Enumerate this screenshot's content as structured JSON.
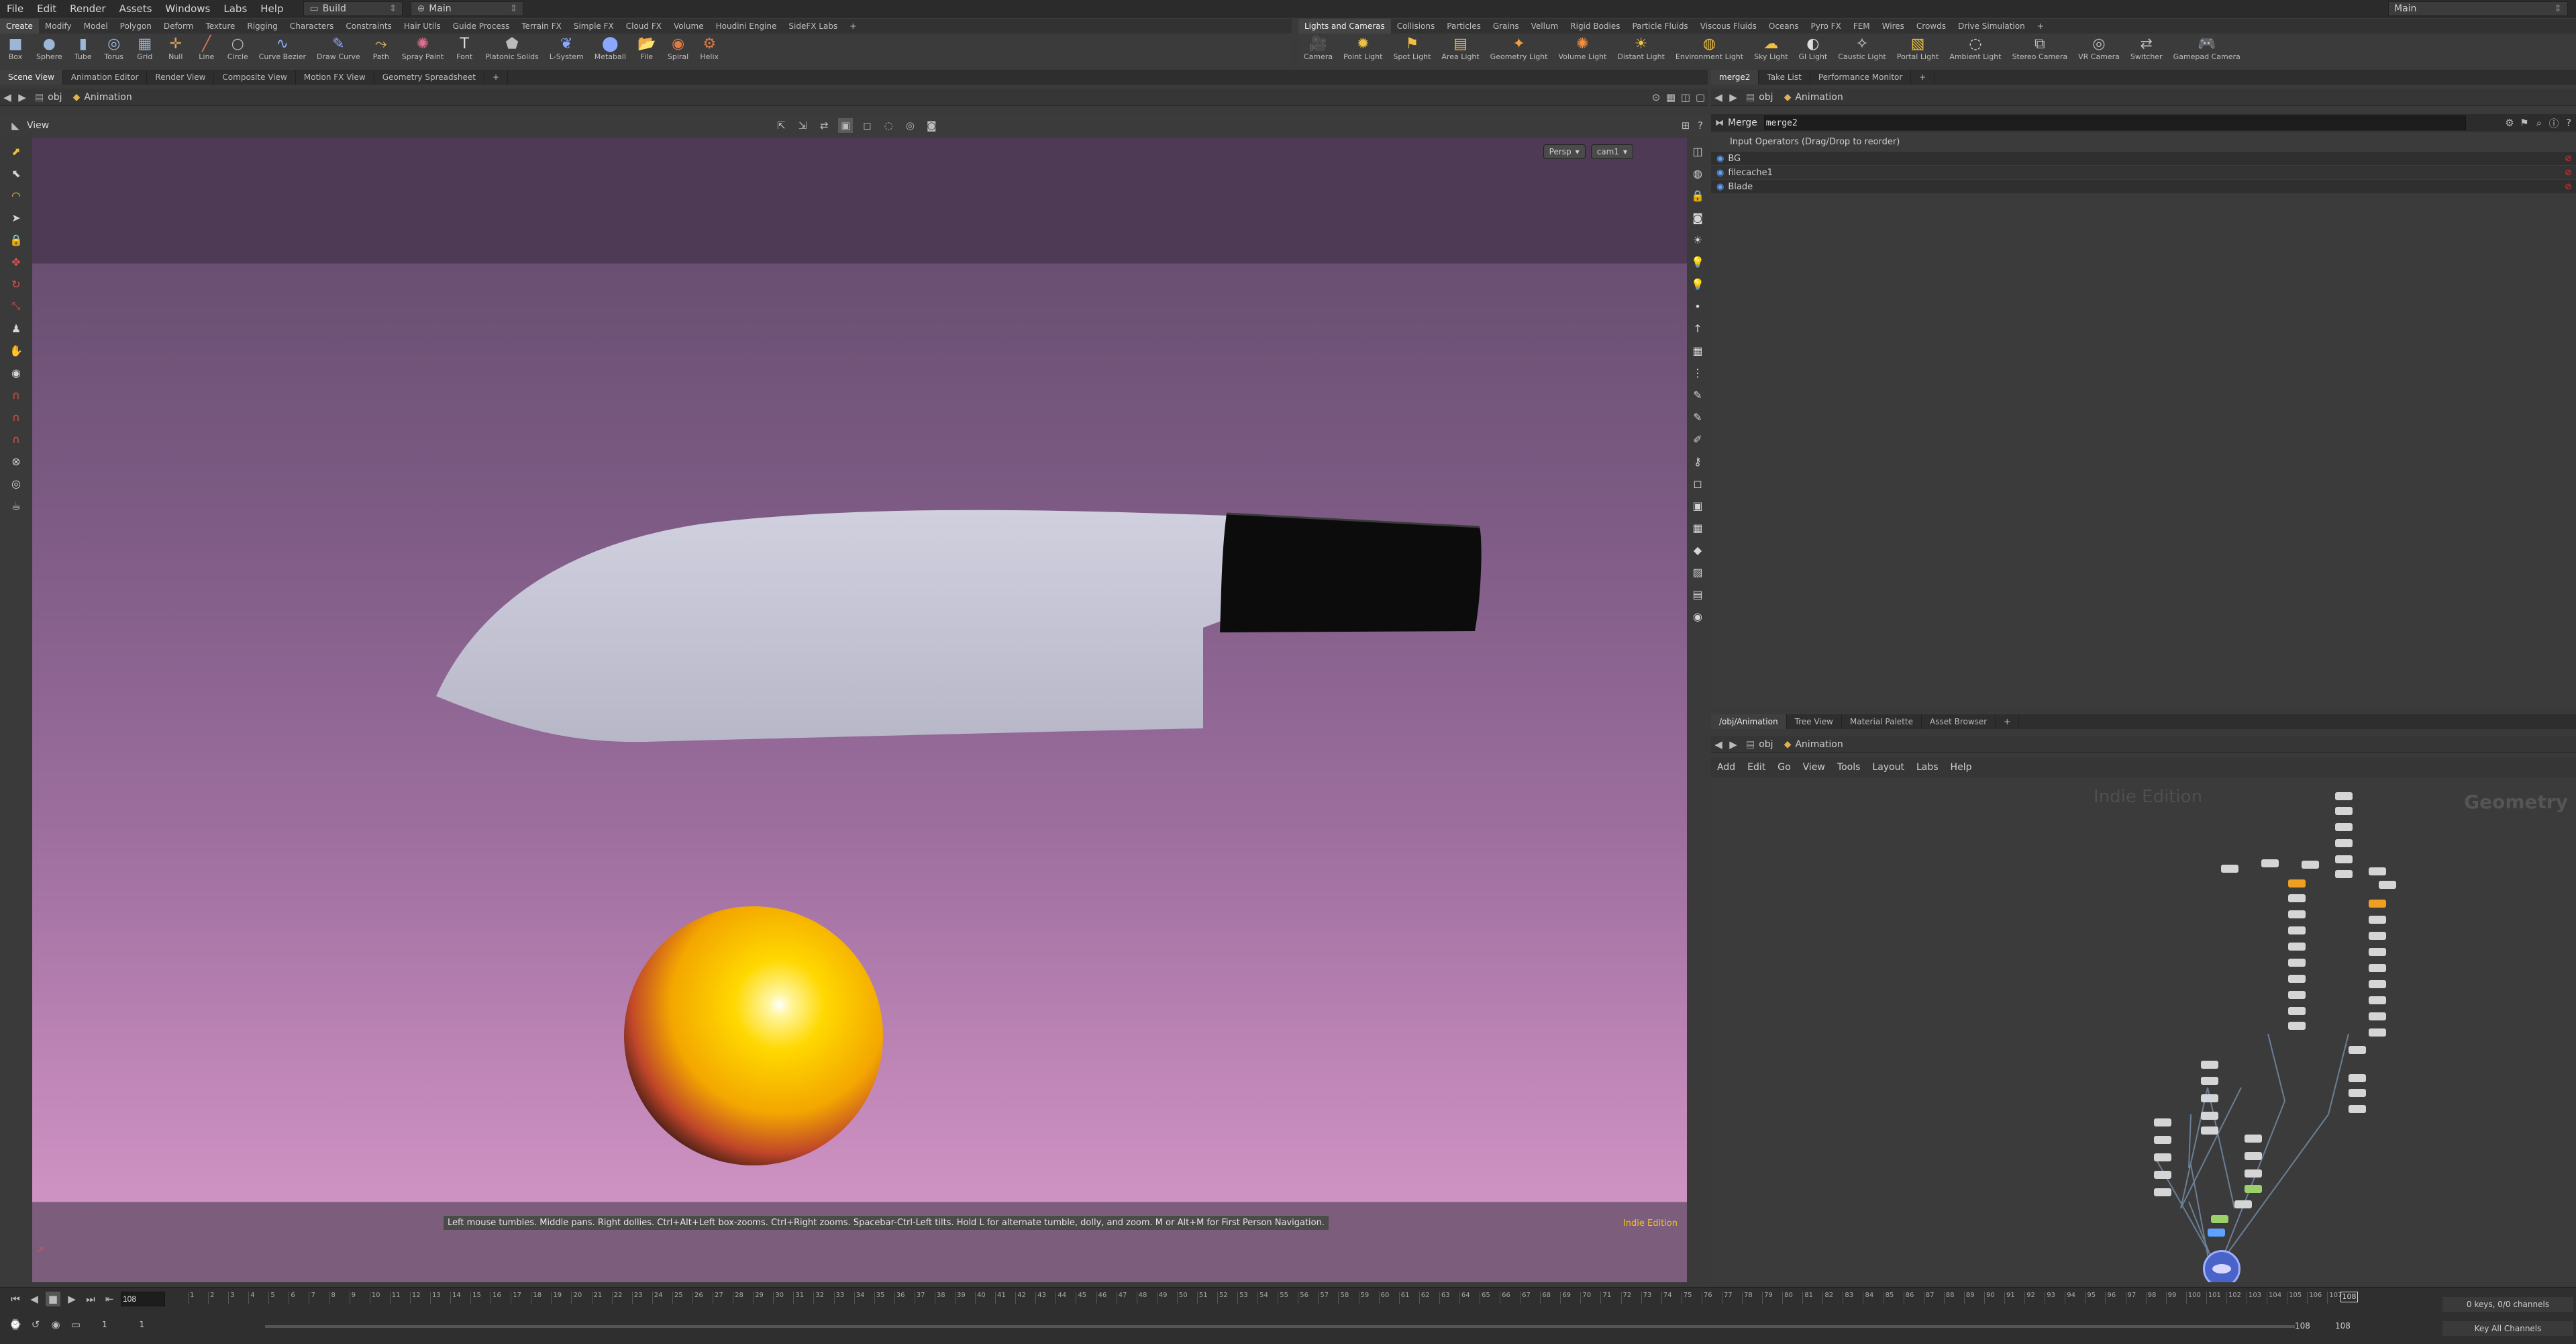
{
  "menubar": {
    "items": [
      "File",
      "Edit",
      "Render",
      "Assets",
      "Windows",
      "Labs",
      "Help"
    ],
    "desktop": "Build",
    "context": "Main",
    "right_desktop": "Main"
  },
  "shelf_left": {
    "tabs": [
      "Create",
      "Modify",
      "Model",
      "Polygon",
      "Deform",
      "Texture",
      "Rigging",
      "Characters",
      "Constraints",
      "Hair Utils",
      "Guide Process",
      "Terrain FX",
      "Simple FX",
      "Cloud FX",
      "Volume",
      "Houdini Engine",
      "SideFX Labs"
    ],
    "tools": [
      {
        "label": "Box",
        "icon": "■",
        "color": "#9bb6d8"
      },
      {
        "label": "Sphere",
        "icon": "●",
        "color": "#9bb6d8"
      },
      {
        "label": "Tube",
        "icon": "▮",
        "color": "#9bb6d8"
      },
      {
        "label": "Torus",
        "icon": "◎",
        "color": "#9bb6d8"
      },
      {
        "label": "Grid",
        "icon": "▦",
        "color": "#9bb6d8"
      },
      {
        "label": "Null",
        "icon": "✛",
        "color": "#d9a060"
      },
      {
        "label": "Line",
        "icon": "╱",
        "color": "#d97a60"
      },
      {
        "label": "Circle",
        "icon": "○",
        "color": "#bbbbbb"
      },
      {
        "label": "Curve Bezier",
        "icon": "∿",
        "color": "#8aa8ff"
      },
      {
        "label": "Draw Curve",
        "icon": "✎",
        "color": "#8aa8ff"
      },
      {
        "label": "Path",
        "icon": "⤳",
        "color": "#e0c060"
      },
      {
        "label": "Spray Paint",
        "icon": "✺",
        "color": "#e07090"
      },
      {
        "label": "Font",
        "icon": "T",
        "color": "#dddddd"
      },
      {
        "label": "Platonic Solids",
        "icon": "⬟",
        "color": "#bbbbbb"
      },
      {
        "label": "L-System",
        "icon": "❦",
        "color": "#8aa8ff"
      },
      {
        "label": "Metaball",
        "icon": "⬤",
        "color": "#8aa8ff"
      },
      {
        "label": "File",
        "icon": "📂",
        "color": "#e0b050"
      },
      {
        "label": "Spiral",
        "icon": "◉",
        "color": "#e07a40"
      },
      {
        "label": "Helix",
        "icon": "⚙",
        "color": "#e07a40"
      }
    ]
  },
  "shelf_right": {
    "tabs": [
      "Lights and Cameras",
      "Collisions",
      "Particles",
      "Grains",
      "Vellum",
      "Rigid Bodies",
      "Particle Fluids",
      "Viscous Fluids",
      "Oceans",
      "Pyro FX",
      "FEM",
      "Wires",
      "Crowds",
      "Drive Simulation"
    ],
    "tools": [
      {
        "label": "Camera",
        "icon": "🎥",
        "color": "#bbbbbb"
      },
      {
        "label": "Point Light",
        "icon": "✹",
        "color": "#f0c040"
      },
      {
        "label": "Spot Light",
        "icon": "⚑",
        "color": "#f0c040"
      },
      {
        "label": "Area Light",
        "icon": "▤",
        "color": "#f0c040"
      },
      {
        "label": "Geometry Light",
        "icon": "✦",
        "color": "#f0a040"
      },
      {
        "label": "Volume Light",
        "icon": "✺",
        "color": "#f09040"
      },
      {
        "label": "Distant Light",
        "icon": "☀",
        "color": "#f0c040"
      },
      {
        "label": "Environment Light",
        "icon": "◍",
        "color": "#f0c040"
      },
      {
        "label": "Sky Light",
        "icon": "☁",
        "color": "#f0c040"
      },
      {
        "label": "GI Light",
        "icon": "◐",
        "color": "#dddddd"
      },
      {
        "label": "Caustic Light",
        "icon": "✧",
        "color": "#dddddd"
      },
      {
        "label": "Portal Light",
        "icon": "▧",
        "color": "#f0c040"
      },
      {
        "label": "Ambient Light",
        "icon": "◌",
        "color": "#dddddd"
      },
      {
        "label": "Stereo Camera",
        "icon": "⧉",
        "color": "#bbbbbb"
      },
      {
        "label": "VR Camera",
        "icon": "◎",
        "color": "#bbbbbb"
      },
      {
        "label": "Switcher",
        "icon": "⇄",
        "color": "#bbbbbb"
      },
      {
        "label": "Gamepad Camera",
        "icon": "🎮",
        "color": "#bbbbbb"
      }
    ]
  },
  "left_pane": {
    "tabs": [
      "Scene View",
      "Animation Editor",
      "Render View",
      "Composite View",
      "Motion FX View",
      "Geometry Spreadsheet"
    ],
    "path": [
      "obj",
      "Animation"
    ],
    "view_label": "View",
    "persp": "Persp",
    "camera": "cam1",
    "status_hint": "Left mouse tumbles. Middle pans. Right dollies. Ctrl+Alt+Left box-zooms. Ctrl+Right zooms. Spacebar-Ctrl-Left tilts. Hold L for alternate tumble, dolly, and zoom.    M or Alt+M for First Person Navigation.",
    "edition": "Indie Edition"
  },
  "param_pane": {
    "tabs": [
      "merge2",
      "Take List",
      "Performance Monitor"
    ],
    "path": [
      "obj",
      "Animation"
    ],
    "node_type": "Merge",
    "node_name": "merge2",
    "section_title": "Input Operators (Drag/Drop to reorder)",
    "inputs": [
      "BG",
      "filecache1",
      "Blade"
    ]
  },
  "network_pane": {
    "tabs": [
      "/obj/Animation",
      "Tree View",
      "Material Palette",
      "Asset Browser"
    ],
    "path": [
      "obj",
      "Animation"
    ],
    "menus": [
      "Add",
      "Edit",
      "Go",
      "View",
      "Tools",
      "Layout",
      "Labs",
      "Help"
    ],
    "watermark": "Indie Edition",
    "context_label": "Geometry"
  },
  "timeline": {
    "current_frame": "108",
    "start": "1",
    "start2": "1",
    "end": "108",
    "end2": "108",
    "ticks": [
      "1",
      "2",
      "3",
      "4",
      "5",
      "6",
      "7",
      "8",
      "9",
      "10",
      "11",
      "12",
      "13",
      "14",
      "15",
      "16",
      "17",
      "18",
      "19",
      "20",
      "21",
      "22",
      "23",
      "24",
      "25",
      "26",
      "27",
      "28",
      "29",
      "30",
      "31",
      "32",
      "33",
      "34",
      "35",
      "36",
      "37",
      "38",
      "39",
      "40",
      "41",
      "42",
      "43",
      "44",
      "45",
      "46",
      "47",
      "48",
      "49",
      "50",
      "51",
      "52",
      "53",
      "54",
      "55",
      "56",
      "57",
      "58",
      "59",
      "60",
      "61",
      "62",
      "63",
      "64",
      "65",
      "66",
      "67",
      "68",
      "69",
      "70",
      "71",
      "72",
      "73",
      "74",
      "75",
      "76",
      "77",
      "78",
      "79",
      "80",
      "81",
      "82",
      "83",
      "84",
      "85",
      "86",
      "87",
      "88",
      "89",
      "90",
      "91",
      "92",
      "93",
      "94",
      "95",
      "96",
      "97",
      "98",
      "99",
      "100",
      "101",
      "102",
      "103",
      "104",
      "105",
      "106",
      "107"
    ],
    "keys_info": "0 keys, 0/0 channels",
    "key_all": "Key All Channels",
    "playhead_marker": "108"
  },
  "colors": {
    "accent": "#f0a020",
    "ball": "#f2c200",
    "handle": "#111111",
    "blade": "#c3c3d3"
  }
}
